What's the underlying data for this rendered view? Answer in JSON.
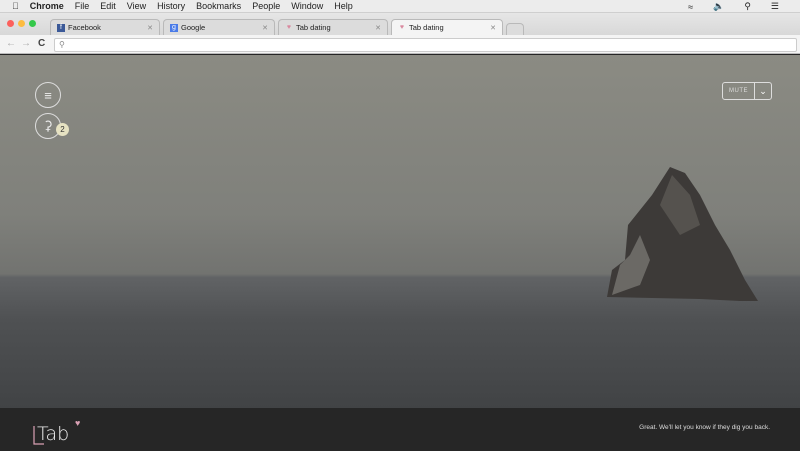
{
  "menubar": {
    "app": "Chrome",
    "items": [
      "File",
      "Edit",
      "View",
      "History",
      "Bookmarks",
      "People",
      "Window",
      "Help"
    ]
  },
  "tabs": [
    {
      "label": "Facebook",
      "icon": "facebook-icon"
    },
    {
      "label": "Google",
      "icon": "google-icon"
    },
    {
      "label": "Tab dating",
      "icon": "heart-icon"
    },
    {
      "label": "Tab dating",
      "icon": "heart-icon",
      "active": true
    }
  ],
  "address": {
    "value": ""
  },
  "page": {
    "notification_count": "2",
    "mute_label": "MUTE"
  },
  "footer": {
    "logo": "Tab",
    "message": "Great. We'll let you know if they dig you back."
  },
  "colors": {
    "accent": "#d9a0b4",
    "footer": "#262626"
  }
}
